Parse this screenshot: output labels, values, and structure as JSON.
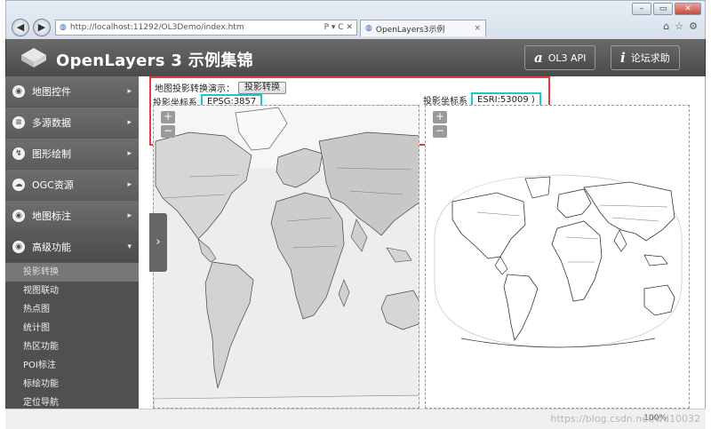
{
  "browser": {
    "url": "http://localhost:11292/OL3Demo/index.htm",
    "search_ctl": "P ▾ C ✕",
    "tab_title": "OpenLayers3示例",
    "tab_close": "×"
  },
  "header": {
    "title": "OpenLayers 3 示例集锦",
    "api_icon": "a",
    "api_label": "OL3 API",
    "forum_icon": "i",
    "forum_label": "论坛求助"
  },
  "sidebar": {
    "items": [
      {
        "label": "地图控件",
        "icon": "◉"
      },
      {
        "label": "多源数据",
        "icon": "≡"
      },
      {
        "label": "图形绘制",
        "icon": "↯"
      },
      {
        "label": "OGC资源",
        "icon": "☁"
      },
      {
        "label": "地图标注",
        "icon": "◉"
      },
      {
        "label": "高级功能",
        "icon": "◉"
      }
    ],
    "sub_items": [
      "投影转换",
      "视图联动",
      "热点图",
      "统计图",
      "热区功能",
      "POI标注",
      "标绘功能",
      "定位导航"
    ]
  },
  "content": {
    "demo_label": "地图投影转换演示：",
    "demo_button": "投影转换",
    "left_proj_label": "投影坐标系",
    "left_proj_value": "EPSG:3857",
    "right_proj_label": "投影坐标系",
    "right_proj_value": "ESRI:53009 )",
    "zoom_in": "+",
    "zoom_out": "−"
  },
  "footer": {
    "watermark": "https://blog.csdn.net/wd10032",
    "zoom": "100%"
  }
}
